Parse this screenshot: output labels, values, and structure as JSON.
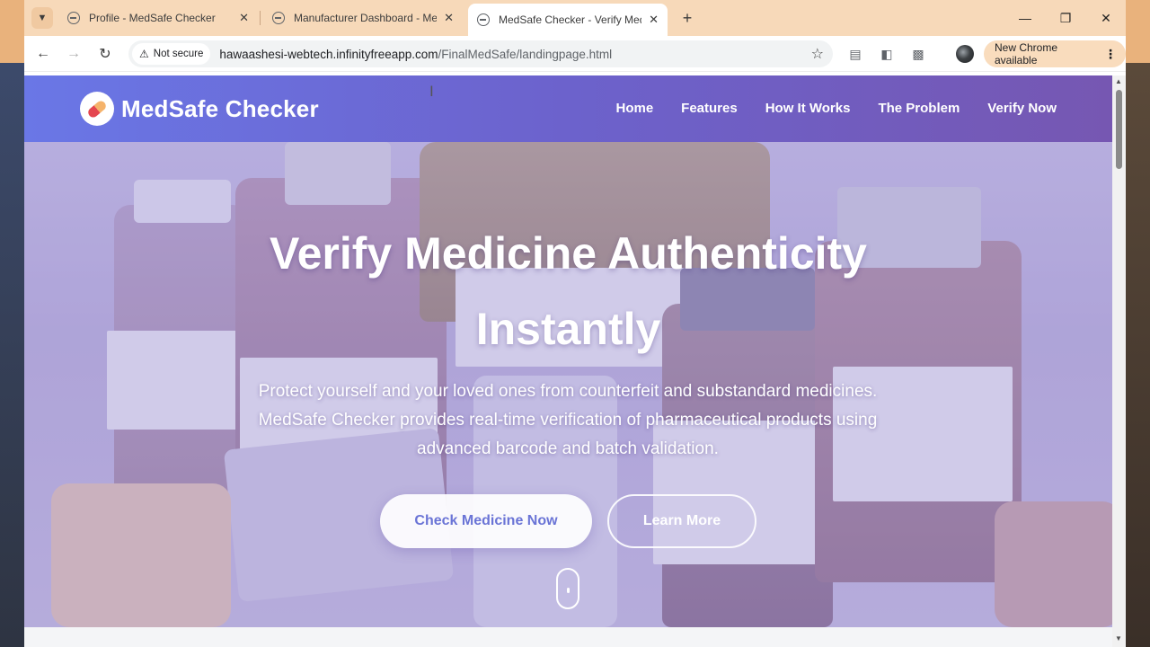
{
  "browser": {
    "tabs": [
      {
        "title": "Profile - MedSafe Checker",
        "active": false
      },
      {
        "title": "Manufacturer Dashboard - Med",
        "active": false
      },
      {
        "title": "MedSafe Checker - Verify Medic",
        "active": true
      }
    ],
    "security_label": "Not secure",
    "url_host": "hawaashesi-webtech.infinityfreeapp.com",
    "url_path": "/FinalMedSafe/landingpage.html",
    "update_chip_label": "New Chrome available"
  },
  "site": {
    "brand_name": "MedSafe Checker",
    "nav": [
      "Home",
      "Features",
      "How It Works",
      "The Problem",
      "Verify Now"
    ],
    "hero": {
      "title_line1": "Verify Medicine Authenticity",
      "title_line2": "Instantly",
      "subtitle_line1": "Protect yourself and your loved ones from counterfeit and substandard medicines.",
      "subtitle_line2": "MedSafe Checker provides real-time verification of pharmaceutical products using",
      "subtitle_line3": "advanced barcode and batch validation.",
      "primary_cta": "Check Medicine Now",
      "secondary_cta": "Learn More"
    }
  },
  "colors": {
    "header_gradient_start": "#6a77e6",
    "header_gradient_end": "#7657b2",
    "primary_cta_text": "#6a74d6",
    "tabstrip": "#f7d9b9"
  }
}
